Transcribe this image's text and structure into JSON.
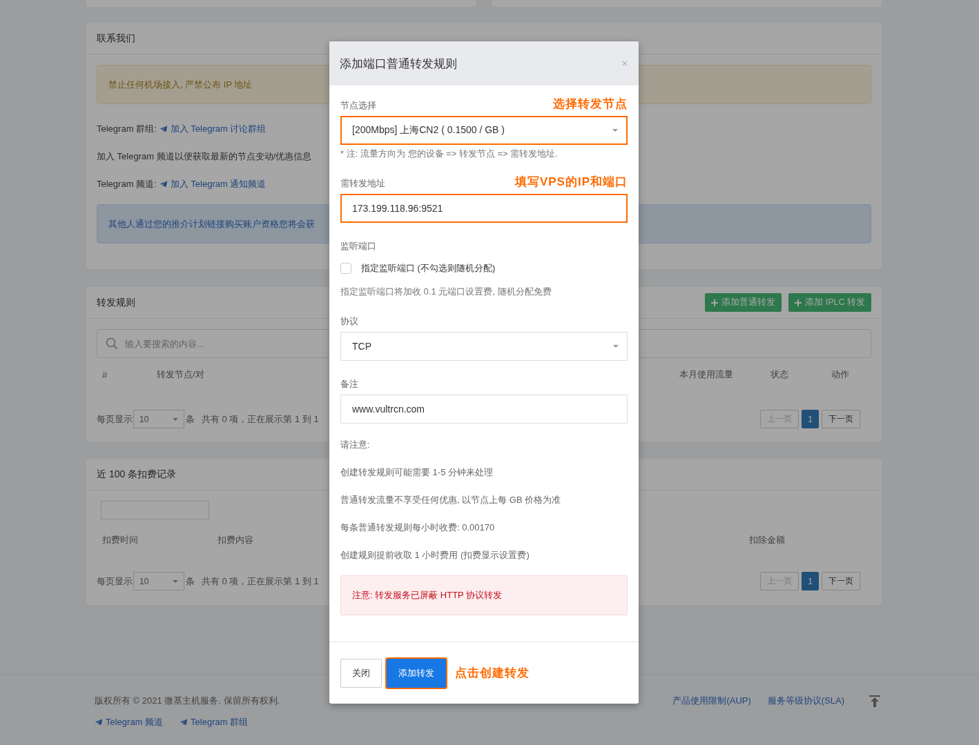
{
  "contact_panel": {
    "title": "联系我们",
    "warning": "禁止任何机场接入, 严禁公布 IP 地址",
    "group_line": {
      "label": "Telegram 群组:",
      "link": "加入 Telegram 讨论群组"
    },
    "channel_note": "加入 Telegram 频道以便获取最新的节点变动/优惠信息",
    "channel_line": {
      "label": "Telegram 频道:",
      "link": "加入 Telegram 通知频道"
    },
    "referral_note": "其他人通过您的推介计划链接购买账户资格您将会获"
  },
  "rules_panel": {
    "title": "转发规则",
    "buttons": [
      "添加普通转发",
      "添加 IPLC 转发"
    ],
    "search": {
      "placeholder": "输入要搜索的内容..."
    },
    "columns": [
      "#",
      "转发节点/对",
      "本月使用流量",
      "状态",
      "动作"
    ],
    "pagination": {
      "per_page_label": "每页显示",
      "page_size": "10",
      "unit": "条",
      "summary": "共有 0 项，正在展示第 1 到 1",
      "prev": {
        "label": "上一页",
        "disabled": true
      },
      "pages": [
        {
          "label": "1",
          "selected": true
        }
      ],
      "next": {
        "label": "下一页",
        "disabled": false
      }
    }
  },
  "billing_panel": {
    "title": "近 100 条扣费记录",
    "columns": [
      "扣费时间",
      "扣费内容",
      "扣除金额"
    ],
    "pagination": {
      "per_page_label": "每页显示",
      "page_size": "10",
      "unit": "条",
      "summary": "共有 0 项，正在展示第 1 到 1",
      "prev": {
        "label": "上一页",
        "disabled": true
      },
      "pages": [
        {
          "label": "1",
          "selected": true
        }
      ],
      "next": {
        "label": "下一页",
        "disabled": false
      }
    }
  },
  "footer": {
    "copyright": "版权所有 © 2021 微基主机服务. 保留所有权利.",
    "links": [
      "产品使用限制(AUP)",
      "服务等级协议(SLA)"
    ],
    "telegram_links": [
      "Telegram 频道",
      "Telegram 群组"
    ]
  },
  "dialog": {
    "title": "添加端口普通转发规则",
    "close": "×",
    "fields": [
      {
        "kind": "select",
        "label": "节点选择",
        "annotation": "选择转发节点",
        "value": "[200Mbps] 上海CN2 ( 0.1500 / GB )",
        "highlighted": true,
        "hint": "* 注: 流量方向为 您的设备 => 转发节点 => 需转发地址."
      },
      {
        "kind": "input",
        "label": "需转发地址",
        "annotation": "填写VPS的IP和端口",
        "value": "173.199.118.96:9521",
        "highlighted": true
      },
      {
        "kind": "checkbox",
        "label": "监听端口",
        "option": "指定监听端口 (不勾选则随机分配)",
        "checked": false,
        "hint": "指定监听端口将加收 0.1 元端口设置费, 随机分配免费"
      },
      {
        "kind": "select",
        "label": "协议",
        "value": "TCP",
        "highlighted": false
      },
      {
        "kind": "input",
        "label": "备注",
        "value": "www.vultrcn.com",
        "highlighted": false
      }
    ],
    "notes_title": "请注意:",
    "notes": [
      "创建转发规则可能需要 1-5 分钟来处理",
      "普通转发流量不享受任何优惠, 以节点上每 GB 价格为准",
      "每条普通转发规则每小时收费: 0.00170",
      "创建规则提前收取 1 小时费用 (扣费显示设置费)"
    ],
    "alert": "注意: 转发服务已屏蔽 HTTP 协议转发",
    "buttons": [
      {
        "kind": "default",
        "label": "关闭",
        "highlighted": false
      },
      {
        "kind": "primary",
        "label": "添加转发",
        "highlighted": true
      }
    ],
    "footer_annotation": "点击创建转发"
  }
}
